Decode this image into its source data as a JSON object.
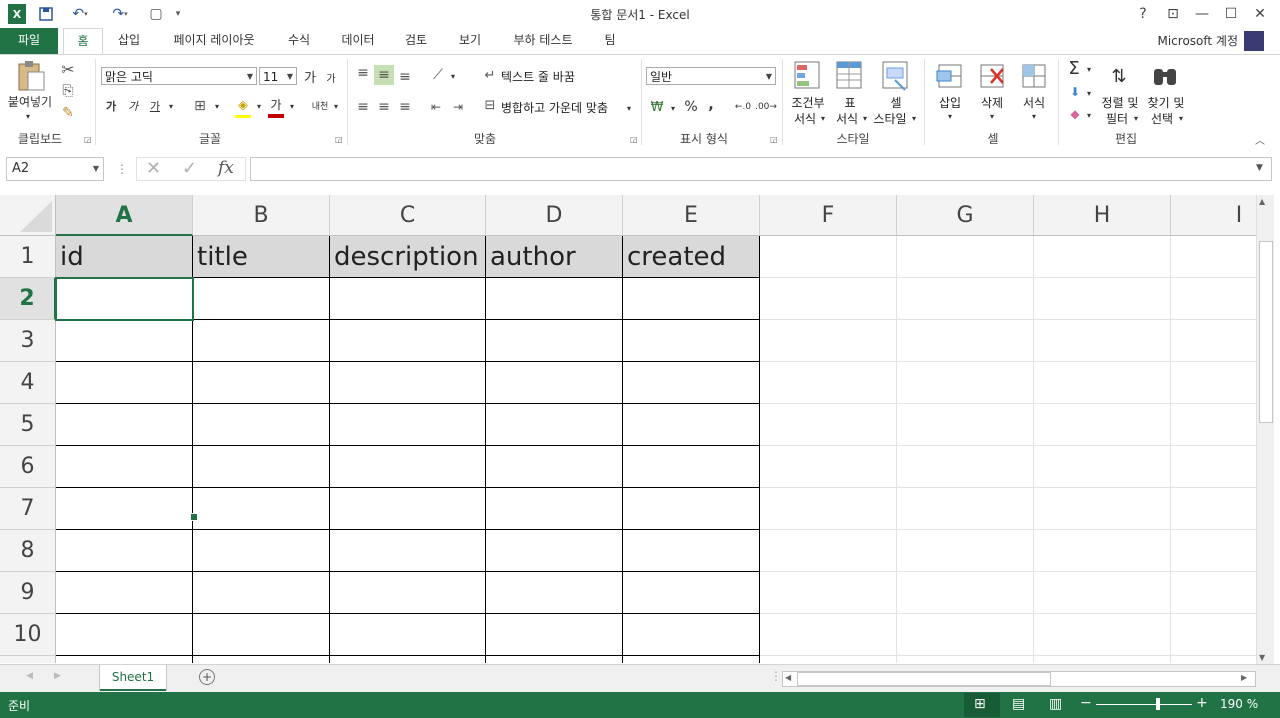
{
  "window": {
    "title": "통합 문서1 - Excel",
    "help_label": "?",
    "account": "Microsoft 계정"
  },
  "ribbon_tabs": [
    "파일",
    "홈",
    "삽입",
    "페이지 레이아웃",
    "수식",
    "데이터",
    "검토",
    "보기",
    "부하 테스트",
    "팀"
  ],
  "ribbon": {
    "clipboard": {
      "paste": "붙여넣기",
      "group": "클립보드"
    },
    "font": {
      "font_name": "맑은 고딕",
      "font_size": "11",
      "bold": "가",
      "italic": "가",
      "underline": "가",
      "grow": "가",
      "shrink": "가",
      "color_letter": "가",
      "phonetic": "내천",
      "group": "글꼴"
    },
    "alignment": {
      "wrap_text": "텍스트 줄 바꿈",
      "merge_center": "병합하고 가운데 맞춤",
      "group": "맞춤"
    },
    "number": {
      "format": "일반",
      "percent": "%",
      "comma": ",",
      "group": "표시 형식"
    },
    "styles": {
      "conditional_1": "조건부",
      "conditional_2": "서식",
      "table_1": "표",
      "table_2": "서식",
      "cell_1": "셀",
      "cell_2": "스타일",
      "group": "스타일"
    },
    "cells": {
      "insert": "삽입",
      "delete": "삭제",
      "format": "서식",
      "group": "셀"
    },
    "editing": {
      "sort_1": "정렬 및",
      "sort_2": "필터",
      "find_1": "찾기 및",
      "find_2": "선택",
      "group": "편집"
    }
  },
  "formula_bar": {
    "name_box": "A2",
    "fx": "fx",
    "value": ""
  },
  "grid": {
    "columns": [
      "A",
      "B",
      "C",
      "D",
      "E",
      "F",
      "G",
      "H",
      "I"
    ],
    "rows": [
      "1",
      "2",
      "3",
      "4",
      "5",
      "6",
      "7",
      "8",
      "9",
      "10"
    ],
    "header_row": [
      "id",
      "title",
      "description",
      "author",
      "created"
    ],
    "active_cell": "A2"
  },
  "sheets": [
    "Sheet1"
  ],
  "status": {
    "ready": "준비",
    "zoom": "190 %"
  },
  "colors": {
    "accent": "#217346",
    "header_fill": "#d9d9d9"
  }
}
